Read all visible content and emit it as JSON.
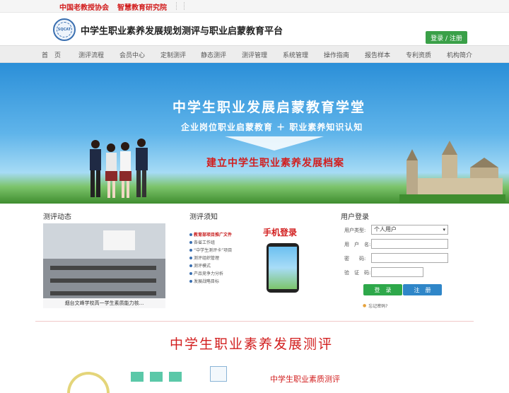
{
  "topbar": {
    "org1": "中国老教授协会",
    "org2": "智慧教育研究院"
  },
  "header": {
    "logo_text": "SQCAT",
    "title": "中学生职业素养发展规划测评与职业启蒙教育平台",
    "login_label": "登录 / 注册"
  },
  "nav": {
    "items": [
      {
        "label": "首　页"
      },
      {
        "label": "测评流程"
      },
      {
        "label": "会员中心"
      },
      {
        "label": "定制测评"
      },
      {
        "label": "静态测评"
      },
      {
        "label": "测评管理"
      },
      {
        "label": "系统管理"
      },
      {
        "label": "操作指南"
      },
      {
        "label": "报告样本"
      },
      {
        "label": "专利资质"
      },
      {
        "label": "机构简介"
      }
    ]
  },
  "banner": {
    "headline": "中学生职业发展启蒙教育学堂",
    "subline": "企业岗位职业启蒙教育 ＋ 职业素养知识认知",
    "tagline": "建立中学生职业素养发展档案"
  },
  "news": {
    "title": "测评动态",
    "caption": "烟台文峰学校高一学生素质能力核..."
  },
  "rules": {
    "title": "测评须知",
    "items": [
      "教育部项目推广文件",
      "各省工作组",
      "“中学生测评卡”项目",
      "测评组织管理",
      "测评模式",
      "产品竞争力分析",
      "发展战略目标"
    ]
  },
  "mobile": {
    "title": "手机登录"
  },
  "login": {
    "title": "用户登录",
    "type_label": "用户类型:",
    "type_value": "个人用户",
    "user_label": "用　户　名:",
    "pass_label": "密　　码:",
    "code_label": "验　证　码:",
    "login_button": "登　录",
    "register_button": "注　册",
    "forgot": "忘记密码?"
  },
  "section": {
    "title": "中学生职业素养发展测评",
    "subtitle": "中学生职业素质测评"
  },
  "colors": {
    "brand_red": "#d21e1e",
    "brand_green": "#3aa048",
    "brand_blue": "#2f86c8"
  }
}
